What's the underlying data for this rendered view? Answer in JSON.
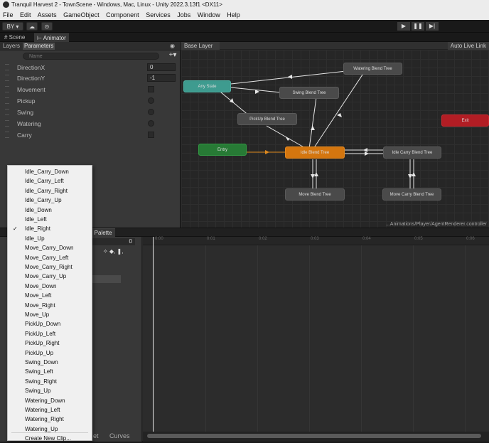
{
  "window": {
    "title": "Tranquil Harvest 2 - TownScene - Windows, Mac, Linux - Unity 2022.3.13f1 <DX11>"
  },
  "menu": [
    "File",
    "Edit",
    "Assets",
    "GameObject",
    "Component",
    "Services",
    "Jobs",
    "Window",
    "Help"
  ],
  "toolbar": {
    "account": "BY ▾",
    "cloud": "☁",
    "settings": "⊙",
    "play": "▶",
    "pause": "❚❚",
    "step": "▶|"
  },
  "tabs": {
    "scene": "# Scene",
    "animator": "⊢ Animator"
  },
  "left_panel": {
    "layers_tab": "Layers",
    "parameters_tab": "Parameters",
    "eye_icon": "◉",
    "search_placeholder": "Name",
    "add_label": "+▾",
    "parameters": [
      {
        "name": "DirectionX",
        "value": "0"
      },
      {
        "name": "DirectionY",
        "value": "-1"
      },
      {
        "name": "Movement"
      },
      {
        "name": "Pickup"
      },
      {
        "name": "Swing"
      },
      {
        "name": "Watering"
      },
      {
        "name": "Carry"
      }
    ]
  },
  "graph": {
    "breadcrumb": "Base Layer",
    "auto_live_link": "Auto Live Link",
    "lock_icon": "a ⋮",
    "path": "...Animations/Player/AgentRenderer.controller",
    "nodes": {
      "any_state": "Any State",
      "entry": "Entry",
      "exit": "Exit",
      "idle": "Idle Blend Tree",
      "watering": "Watering Blend Tree",
      "swing": "Swing Blend Tree",
      "pickup": "PickUp Blend Tree",
      "idle_carry": "Idle Carry Blend Tree",
      "move": "Move Blend Tree",
      "move_carry": "Move Carry Blend Tree"
    }
  },
  "animation_panel": {
    "palette_partial": "e Palette",
    "frame_value": "0",
    "frame_value2": "0",
    "dopesheet_partial": "et",
    "curves": "Curves",
    "time_ticks": [
      "0:00",
      "0:01",
      "0:02",
      "0:03",
      "0:04",
      "0:05",
      "0:06"
    ]
  },
  "clip_dropdown": {
    "selected": "Idle_Right",
    "items": [
      "Idle_Carry_Down",
      "Idle_Carry_Left",
      "Idle_Carry_Right",
      "Idle_Carry_Up",
      "Idle_Down",
      "Idle_Left",
      "Idle_Right",
      "Idle_Up",
      "Move_Carry_Down",
      "Move_Carry_Left",
      "Move_Carry_Right",
      "Move_Carry_Up",
      "Move_Down",
      "Move_Left",
      "Move_Right",
      "Move_Up",
      "PickUp_Down",
      "PickUp_Left",
      "PickUp_Right",
      "PickUp_Up",
      "Swing_Down",
      "Swing_Left",
      "Swing_Right",
      "Swing_Up",
      "Watering_Down",
      "Watering_Left",
      "Watering_Right",
      "Watering_Up"
    ],
    "create_new": "Create New Clip..."
  },
  "colors": {
    "any_state": "#3e9b8f",
    "entry": "#277a35",
    "exit": "#b21d24",
    "default_state": "#d4760f",
    "playhead": "#e8e8e8"
  }
}
